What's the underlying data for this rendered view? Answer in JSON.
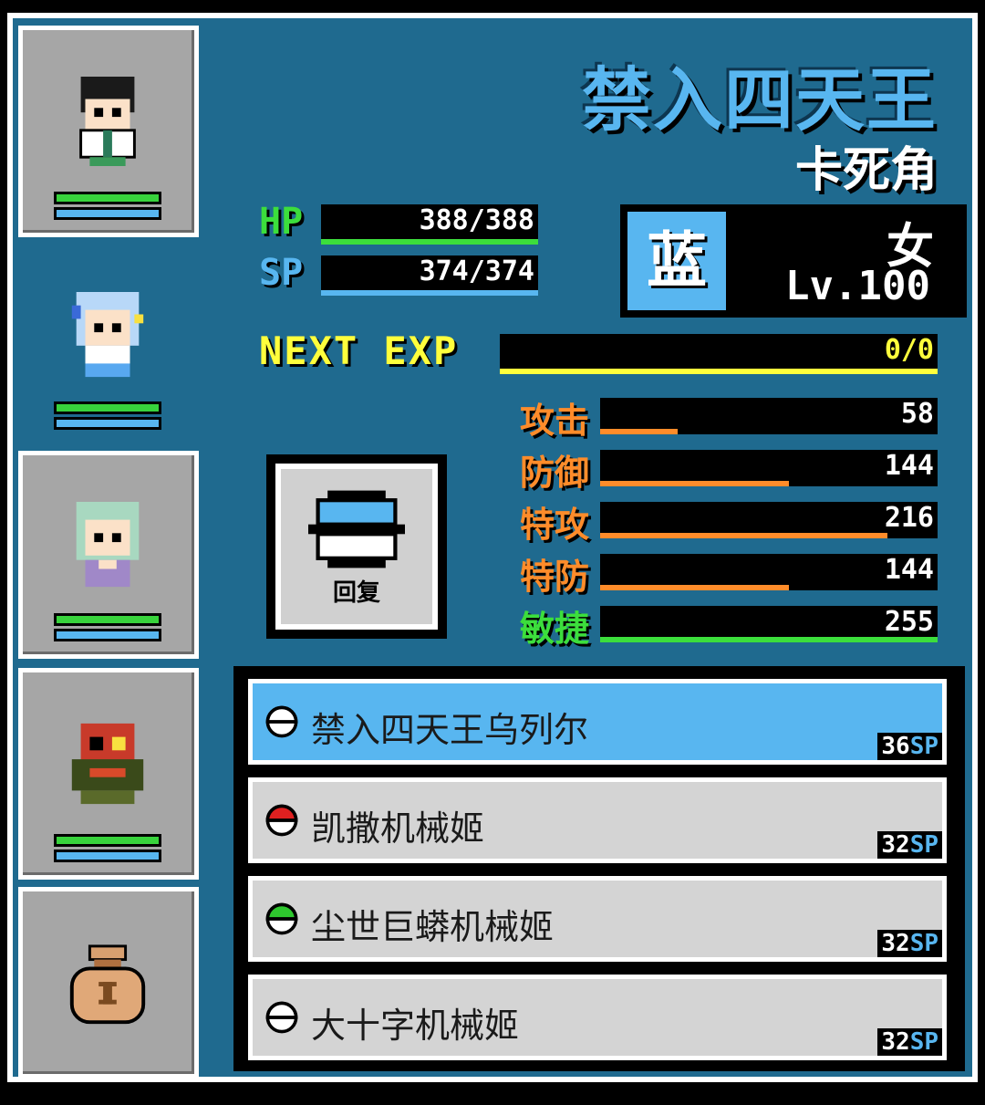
{
  "character": {
    "title": "禁入四天王",
    "subtitle": "卡死角",
    "hp": "388/388",
    "sp": "374/374",
    "hp_label": "HP",
    "sp_label": "SP",
    "type": "蓝",
    "gender": "女",
    "level": "Lv.100",
    "next_exp_label": "NEXT EXP",
    "next_exp": "0/0"
  },
  "stats": [
    {
      "label": "攻击",
      "value": "58",
      "fill": 0.23,
      "color": "#ff8c2a"
    },
    {
      "label": "防御",
      "value": "144",
      "fill": 0.56,
      "color": "#ff8c2a"
    },
    {
      "label": "特攻",
      "value": "216",
      "fill": 0.85,
      "color": "#ff8c2a"
    },
    {
      "label": "特防",
      "value": "144",
      "fill": 0.56,
      "color": "#ff8c2a"
    },
    {
      "label": "敏捷",
      "value": "255",
      "fill": 1.0,
      "color": "#3cde3c"
    }
  ],
  "skill_button": {
    "label": "回复",
    "icon": "ball-blue-icon"
  },
  "moves": [
    {
      "name": "禁入四天王乌列尔",
      "cost": "36",
      "unit": "SP",
      "ball": "#ffffff",
      "selected": true
    },
    {
      "name": "凯撒机械姬",
      "cost": "32",
      "unit": "SP",
      "ball": "#e02020",
      "selected": false
    },
    {
      "name": "尘世巨蟒机械姬",
      "cost": "32",
      "unit": "SP",
      "ball": "#2ec82e",
      "selected": false
    },
    {
      "name": "大十字机械姬",
      "cost": "32",
      "unit": "SP",
      "ball": "#ffffff",
      "selected": false
    }
  ],
  "party_icons": [
    "party-member-1-sprite",
    "party-member-2-sprite",
    "party-member-3-sprite",
    "party-member-4-sprite",
    "item-bag-icon"
  ]
}
